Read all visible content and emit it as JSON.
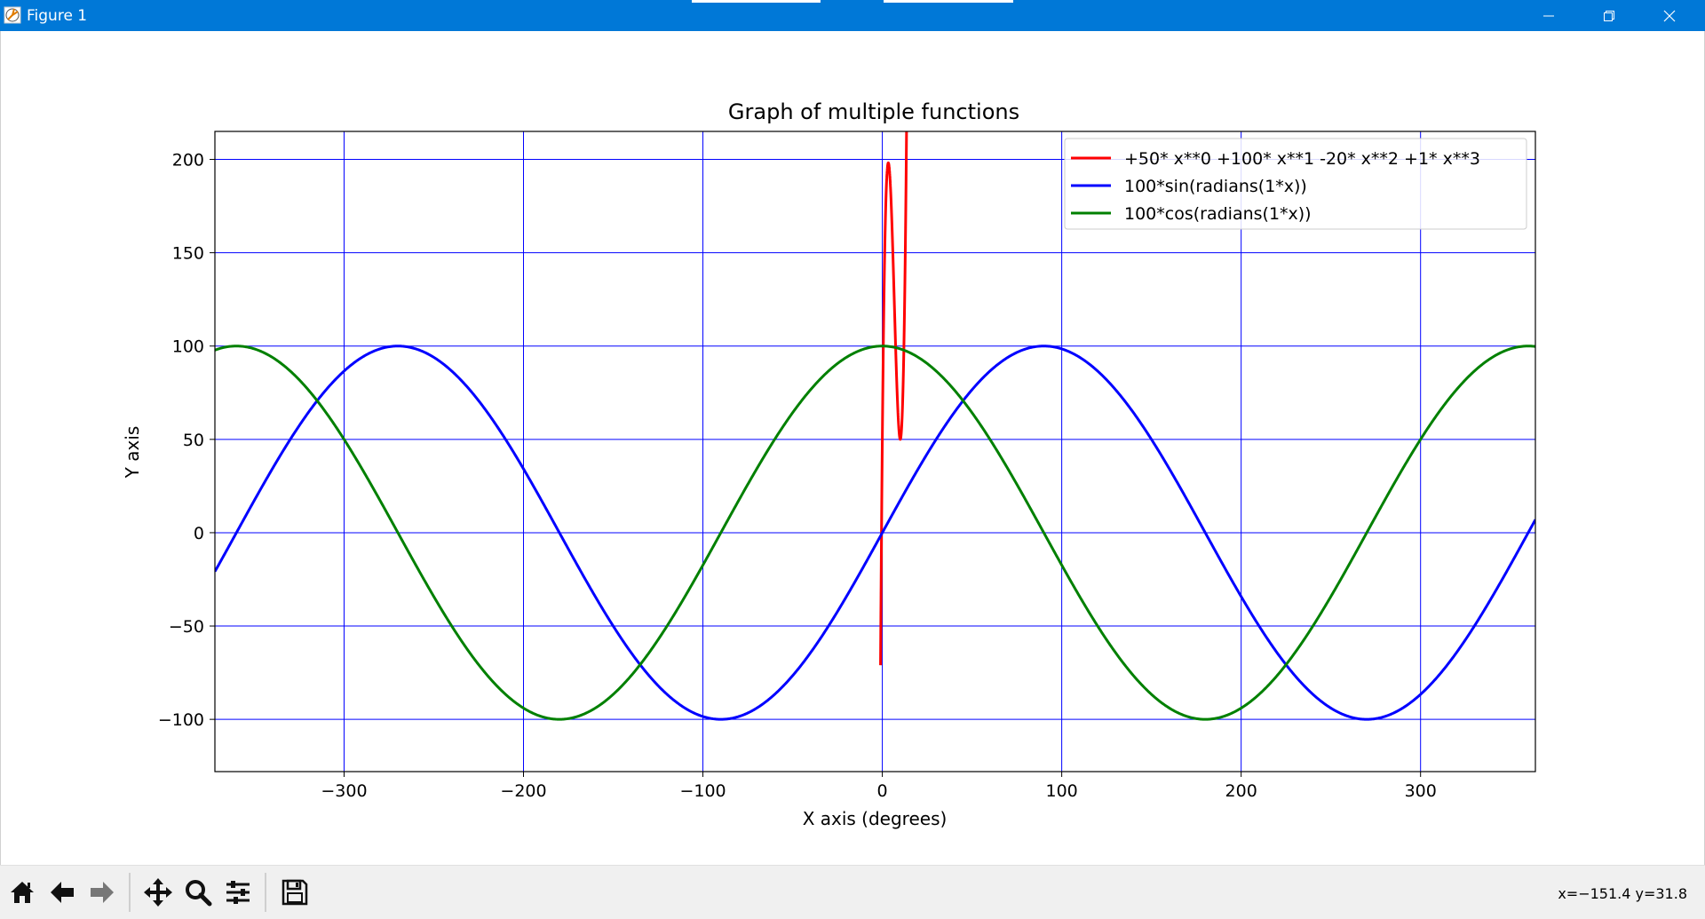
{
  "window": {
    "title": "Figure 1",
    "controls": [
      "minimize",
      "restore",
      "close"
    ]
  },
  "toolbar": {
    "buttons": [
      "home-icon",
      "back-icon",
      "forward-icon",
      "pan-icon",
      "zoom-icon",
      "configure-subplots-icon",
      "save-icon"
    ],
    "coords_readout": "x=−151.4 y=31.8"
  },
  "chart_data": {
    "type": "line",
    "title": "Graph of multiple functions",
    "xlabel": "X axis (degrees)",
    "ylabel": "Y axis",
    "xlim": [
      -372,
      364
    ],
    "ylim": [
      -128,
      215
    ],
    "xticks": [
      -300,
      -200,
      -100,
      0,
      100,
      200,
      300
    ],
    "xtick_labels": [
      "−300",
      "−200",
      "−100",
      "0",
      "100",
      "200",
      "300"
    ],
    "yticks": [
      200,
      150,
      100,
      50,
      0,
      -50,
      -100
    ],
    "ytick_labels": [
      "200",
      "150",
      "100",
      "50",
      "0",
      "−50",
      "−100"
    ],
    "grid": true,
    "grid_color": "#0000ff",
    "legend_position": "top-right",
    "series": [
      {
        "name": " +50* x**0 +100* x**1 -20* x**2 +1* x**3",
        "color": "#ff0000",
        "formula": "poly",
        "coefficients": [
          50,
          100,
          -20,
          1
        ],
        "x_range": [
          -1,
          15
        ]
      },
      {
        "name": "100*sin(radians(1*x))",
        "color": "#0000ff",
        "formula": "sin",
        "amplitude": 100,
        "x_range": [
          -372,
          364
        ]
      },
      {
        "name": "100*cos(radians(1*x))",
        "color": "#008000",
        "formula": "cos",
        "amplitude": 100,
        "x_range": [
          -372,
          364
        ]
      }
    ]
  }
}
